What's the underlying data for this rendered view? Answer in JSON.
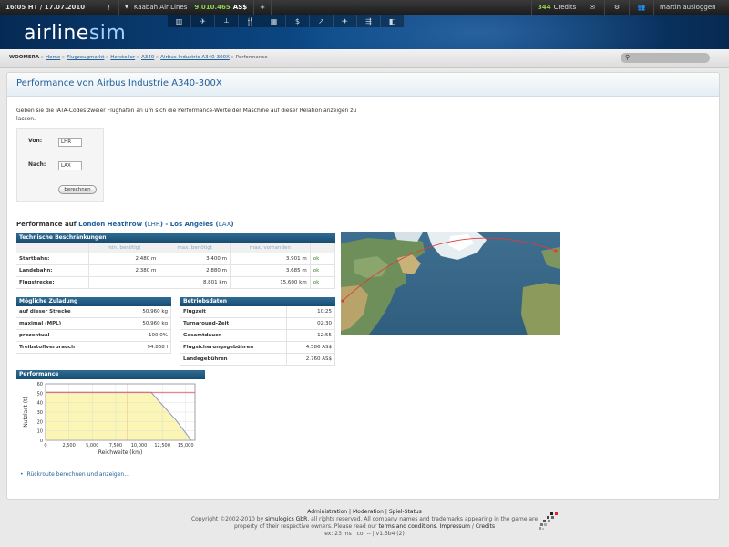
{
  "topbar": {
    "time": "16:05 HT / 17.07.2010",
    "info_icon": "info-icon",
    "airline": "Kaabah Air Lines",
    "money": "9.010.465",
    "currency": "AS$",
    "plus": "+",
    "credits_count": "344",
    "credits_label": "Credits",
    "user_link": "martin ausloggen"
  },
  "logo": {
    "part1": "airline",
    "part2": "sim"
  },
  "nav_icons": [
    "building-icon",
    "plane-icon",
    "aircraft-icon",
    "food-icon",
    "chart-icon",
    "dollar-icon",
    "trend-icon",
    "plane-small-icon",
    "jet-icon",
    "misc-icon"
  ],
  "breadcrumb": {
    "root": "WOOMERA",
    "items": [
      "Home",
      "Flugzeugmarkt",
      "Hersteller",
      "A340",
      "Airbus Industrie A340-300X"
    ],
    "current": "Performance",
    "sep": "»"
  },
  "page": {
    "title": "Performance von Airbus Industrie A340-300X",
    "intro": "Geben sie die IATA-Codes zweier Flughäfen an um sich die Performance-Werte der Maschine auf dieser Relation anzeigen zu lassen."
  },
  "form": {
    "von_label": "Von:",
    "von_value": "LHR",
    "nach_label": "Nach:",
    "nach_value": "LAX",
    "submit": "berechnen"
  },
  "perf_header": {
    "prefix": "Performance auf",
    "from_city": "London Heathrow",
    "from_code": "LHR",
    "dash": "-",
    "to_city": "Los Angeles",
    "to_code": "LAX"
  },
  "tech": {
    "title": "Technische Beschränkungen",
    "cols": [
      "min. benötigt",
      "max. benötigt",
      "max. vorhanden"
    ],
    "rows": [
      {
        "label": "Startbahn:",
        "min": "2.480 m",
        "max": "3.400 m",
        "avail": "3.901 m",
        "status": "ok"
      },
      {
        "label": "Landebahn:",
        "min": "2.380 m",
        "max": "2.880 m",
        "avail": "3.685 m",
        "status": "ok"
      },
      {
        "label": "Flugstrecke:",
        "min": "",
        "max": "8.801 km",
        "avail": "15.600 km",
        "status": "ok"
      }
    ]
  },
  "payload": {
    "title": "Mögliche Zuladung",
    "rows": [
      {
        "label": "auf dieser Strecke",
        "value": "50.960 kg"
      },
      {
        "label": "maximal (MPL)",
        "value": "50.960 kg"
      },
      {
        "label": "prozentual",
        "value": "100,0%"
      },
      {
        "label": "Treibstoffverbrauch",
        "value": "94.868 l"
      }
    ]
  },
  "ops": {
    "title": "Betriebsdaten",
    "rows": [
      {
        "label": "Flugzeit",
        "value": "10:25"
      },
      {
        "label": "Turnaround-Zeit",
        "value": "02:30"
      },
      {
        "label": "Gesamtdauer",
        "value": "12:55"
      },
      {
        "label": "Flugsicherungsgebühren",
        "value": "4.586 AS$"
      },
      {
        "label": "Landegebühren",
        "value": "2.760 AS$"
      }
    ]
  },
  "perf_chart_title": "Performance",
  "chart_data": {
    "type": "line",
    "title": "",
    "xlabel": "Reichweite (km)",
    "ylabel": "Nutzlast (t)",
    "xlim": [
      0,
      16000
    ],
    "ylim": [
      0,
      60
    ],
    "xticks": [
      0,
      2500,
      5000,
      7500,
      10000,
      12500,
      15000
    ],
    "xtick_labels": [
      "0",
      "2,500",
      "5,000",
      "7,500",
      "10,000",
      "12,500",
      "15,000"
    ],
    "yticks": [
      0,
      10,
      20,
      30,
      40,
      50,
      60
    ],
    "ytick_labels": [
      "0",
      "10",
      "20",
      "30",
      "40",
      "50",
      "60"
    ],
    "grid": true,
    "series": [
      {
        "x": [
          0,
          11300,
          14000,
          15600
        ],
        "y": [
          51,
          51,
          21,
          0
        ],
        "color": "#8a96c8"
      }
    ],
    "fill_color": "#fbf6b6",
    "reference_lines": {
      "distance": 8801,
      "payload": 51,
      "color": "#e05a6a"
    }
  },
  "links": {
    "rueckroute": "Rückroute berechnen und anzeigen..."
  },
  "footer": {
    "nav": [
      "Administration",
      "Moderation",
      "Spiel-Status"
    ],
    "nav_sep": "|",
    "copyright_a": "Copyright ©2002-2010 by",
    "copyright_company": "simulogics GbR",
    "copyright_b": ", all rights reserved. All company names and trademarks appearing in the game are",
    "copyright_c": "property of their respective owners. Please read our",
    "terms": "terms and conditions",
    "impressum": "Impressum",
    "credits": "Credits",
    "stats": "ex: 23 ms | co: -- | v1.5b4 (2)"
  }
}
